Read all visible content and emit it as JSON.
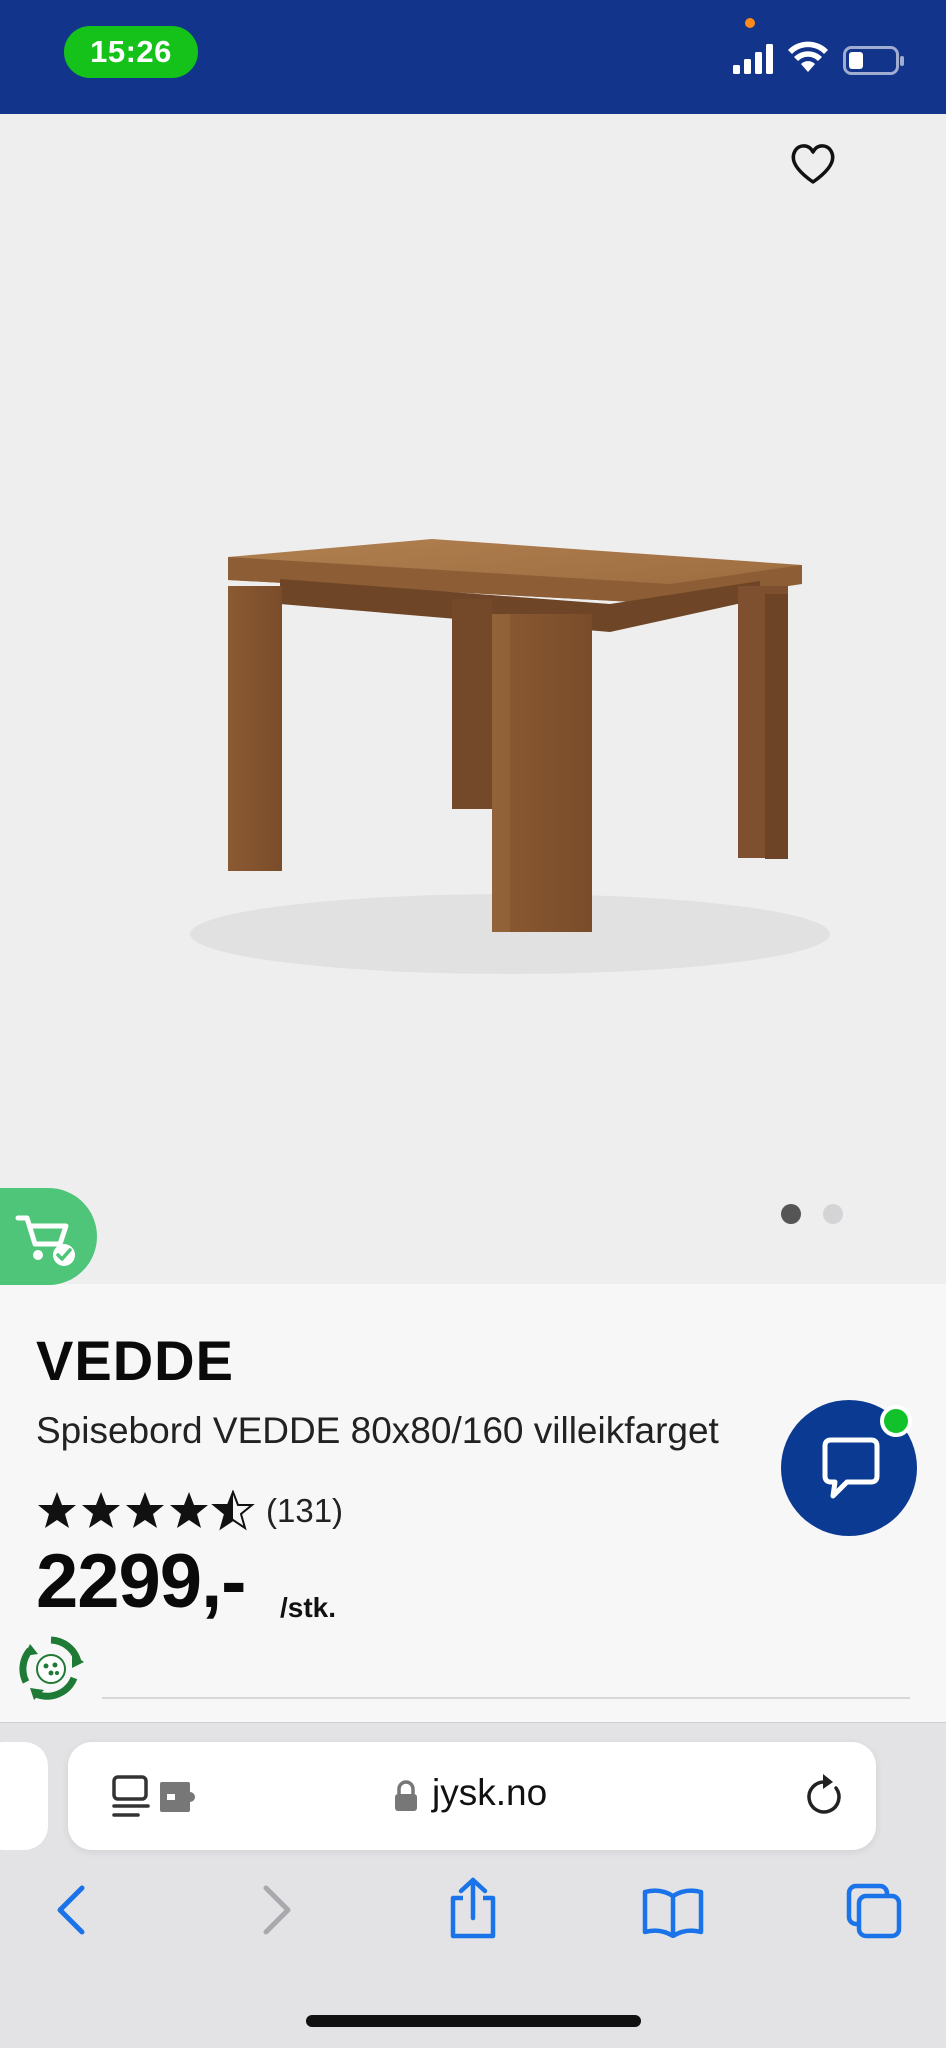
{
  "status_bar": {
    "time": "15:26",
    "background_color": "#12348a",
    "time_pill_color": "#15c21a",
    "icons": [
      "cellular-signal-icon",
      "wifi-icon",
      "battery-icon"
    ]
  },
  "product_gallery": {
    "image_alt": "VEDDE dining table",
    "active_slide": 1,
    "total_slides": 2,
    "wishlist_icon": "heart-outline-icon"
  },
  "product": {
    "brand": "VEDDE",
    "name": "Spisebord VEDDE 80x80/160 villeikfarget",
    "rating": 4.5,
    "rating_max": 5,
    "review_count": "(131)",
    "price": "2299,-",
    "unit": "/stk."
  },
  "floating": {
    "cart_badge_icon": "cart-check-icon",
    "chat_icon": "chat-bubble-icon",
    "eco_icon": "recycle-icon",
    "accent_color": "#0a3a92",
    "online_color": "#12c22a"
  },
  "browser": {
    "domain": "jysk.no",
    "nav": [
      "back-icon",
      "forward-icon",
      "share-icon",
      "bookmarks-icon",
      "tabs-icon"
    ],
    "accent_color": "#1a73e8"
  }
}
